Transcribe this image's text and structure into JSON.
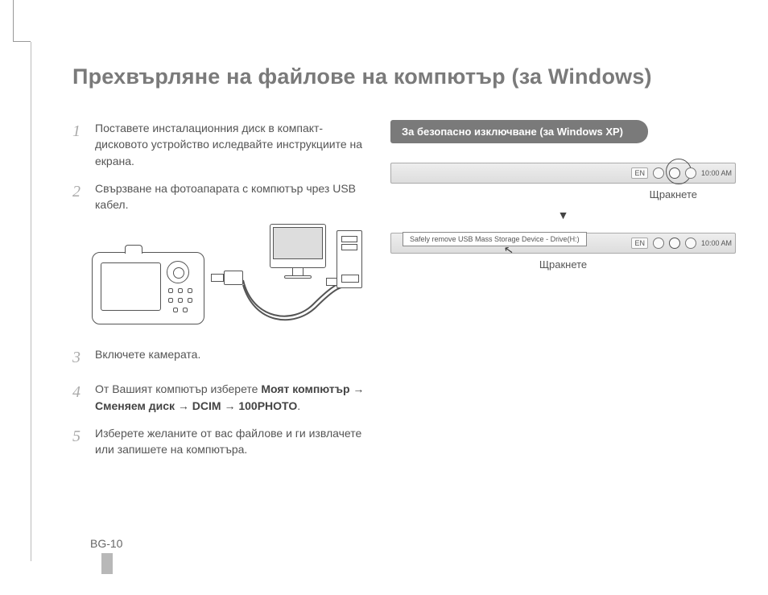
{
  "page_title": "Прехвърляне на файлове на компютър (за Windows)",
  "steps": [
    {
      "num": "1",
      "text": "Поставете инсталационния диск в компакт-дисковото устройство иследвайте инструкциите на екрана."
    },
    {
      "num": "2",
      "text": "Свързване на фотоапарата с компютър чрез USB кабел."
    },
    {
      "num": "3",
      "text": "Включете камерата."
    },
    {
      "num": "4",
      "text_pre": "От Вашият компютър изберете",
      "path": "Моят компютър → Сменяем диск → DCIM → 100PHOTO",
      "text_post": "."
    },
    {
      "num": "5",
      "text": "Изберете желаните от вас файлове и ги извлачете или запишете на компютъра."
    }
  ],
  "right": {
    "callout": "За безопасно изключване (за Windows XP)",
    "lang": "EN",
    "clock": "10:00 AM",
    "click_label": "Щракнете",
    "tooltip": "Safely remove USB Mass Storage Device - Drive(H:)"
  },
  "page_number": "BG-10"
}
